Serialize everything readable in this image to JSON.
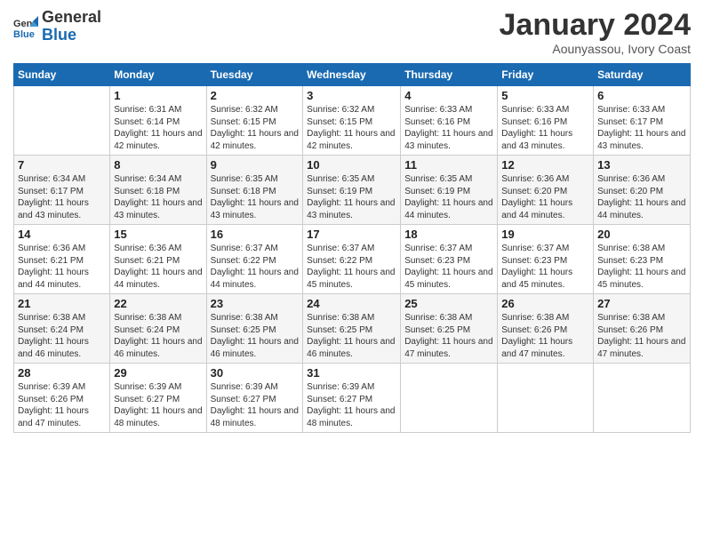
{
  "logo": {
    "line1": "General",
    "line2": "Blue"
  },
  "title": "January 2024",
  "subtitle": "Aounyassou, Ivory Coast",
  "headers": [
    "Sunday",
    "Monday",
    "Tuesday",
    "Wednesday",
    "Thursday",
    "Friday",
    "Saturday"
  ],
  "weeks": [
    [
      {
        "day": "",
        "info": ""
      },
      {
        "day": "1",
        "info": "Sunrise: 6:31 AM\nSunset: 6:14 PM\nDaylight: 11 hours\nand 42 minutes."
      },
      {
        "day": "2",
        "info": "Sunrise: 6:32 AM\nSunset: 6:15 PM\nDaylight: 11 hours\nand 42 minutes."
      },
      {
        "day": "3",
        "info": "Sunrise: 6:32 AM\nSunset: 6:15 PM\nDaylight: 11 hours\nand 42 minutes."
      },
      {
        "day": "4",
        "info": "Sunrise: 6:33 AM\nSunset: 6:16 PM\nDaylight: 11 hours\nand 43 minutes."
      },
      {
        "day": "5",
        "info": "Sunrise: 6:33 AM\nSunset: 6:16 PM\nDaylight: 11 hours\nand 43 minutes."
      },
      {
        "day": "6",
        "info": "Sunrise: 6:33 AM\nSunset: 6:17 PM\nDaylight: 11 hours\nand 43 minutes."
      }
    ],
    [
      {
        "day": "7",
        "info": "Sunrise: 6:34 AM\nSunset: 6:17 PM\nDaylight: 11 hours\nand 43 minutes."
      },
      {
        "day": "8",
        "info": "Sunrise: 6:34 AM\nSunset: 6:18 PM\nDaylight: 11 hours\nand 43 minutes."
      },
      {
        "day": "9",
        "info": "Sunrise: 6:35 AM\nSunset: 6:18 PM\nDaylight: 11 hours\nand 43 minutes."
      },
      {
        "day": "10",
        "info": "Sunrise: 6:35 AM\nSunset: 6:19 PM\nDaylight: 11 hours\nand 43 minutes."
      },
      {
        "day": "11",
        "info": "Sunrise: 6:35 AM\nSunset: 6:19 PM\nDaylight: 11 hours\nand 44 minutes."
      },
      {
        "day": "12",
        "info": "Sunrise: 6:36 AM\nSunset: 6:20 PM\nDaylight: 11 hours\nand 44 minutes."
      },
      {
        "day": "13",
        "info": "Sunrise: 6:36 AM\nSunset: 6:20 PM\nDaylight: 11 hours\nand 44 minutes."
      }
    ],
    [
      {
        "day": "14",
        "info": "Sunrise: 6:36 AM\nSunset: 6:21 PM\nDaylight: 11 hours\nand 44 minutes."
      },
      {
        "day": "15",
        "info": "Sunrise: 6:36 AM\nSunset: 6:21 PM\nDaylight: 11 hours\nand 44 minutes."
      },
      {
        "day": "16",
        "info": "Sunrise: 6:37 AM\nSunset: 6:22 PM\nDaylight: 11 hours\nand 44 minutes."
      },
      {
        "day": "17",
        "info": "Sunrise: 6:37 AM\nSunset: 6:22 PM\nDaylight: 11 hours\nand 45 minutes."
      },
      {
        "day": "18",
        "info": "Sunrise: 6:37 AM\nSunset: 6:23 PM\nDaylight: 11 hours\nand 45 minutes."
      },
      {
        "day": "19",
        "info": "Sunrise: 6:37 AM\nSunset: 6:23 PM\nDaylight: 11 hours\nand 45 minutes."
      },
      {
        "day": "20",
        "info": "Sunrise: 6:38 AM\nSunset: 6:23 PM\nDaylight: 11 hours\nand 45 minutes."
      }
    ],
    [
      {
        "day": "21",
        "info": "Sunrise: 6:38 AM\nSunset: 6:24 PM\nDaylight: 11 hours\nand 46 minutes."
      },
      {
        "day": "22",
        "info": "Sunrise: 6:38 AM\nSunset: 6:24 PM\nDaylight: 11 hours\nand 46 minutes."
      },
      {
        "day": "23",
        "info": "Sunrise: 6:38 AM\nSunset: 6:25 PM\nDaylight: 11 hours\nand 46 minutes."
      },
      {
        "day": "24",
        "info": "Sunrise: 6:38 AM\nSunset: 6:25 PM\nDaylight: 11 hours\nand 46 minutes."
      },
      {
        "day": "25",
        "info": "Sunrise: 6:38 AM\nSunset: 6:25 PM\nDaylight: 11 hours\nand 47 minutes."
      },
      {
        "day": "26",
        "info": "Sunrise: 6:38 AM\nSunset: 6:26 PM\nDaylight: 11 hours\nand 47 minutes."
      },
      {
        "day": "27",
        "info": "Sunrise: 6:38 AM\nSunset: 6:26 PM\nDaylight: 11 hours\nand 47 minutes."
      }
    ],
    [
      {
        "day": "28",
        "info": "Sunrise: 6:39 AM\nSunset: 6:26 PM\nDaylight: 11 hours\nand 47 minutes."
      },
      {
        "day": "29",
        "info": "Sunrise: 6:39 AM\nSunset: 6:27 PM\nDaylight: 11 hours\nand 48 minutes."
      },
      {
        "day": "30",
        "info": "Sunrise: 6:39 AM\nSunset: 6:27 PM\nDaylight: 11 hours\nand 48 minutes."
      },
      {
        "day": "31",
        "info": "Sunrise: 6:39 AM\nSunset: 6:27 PM\nDaylight: 11 hours\nand 48 minutes."
      },
      {
        "day": "",
        "info": ""
      },
      {
        "day": "",
        "info": ""
      },
      {
        "day": "",
        "info": ""
      }
    ]
  ]
}
